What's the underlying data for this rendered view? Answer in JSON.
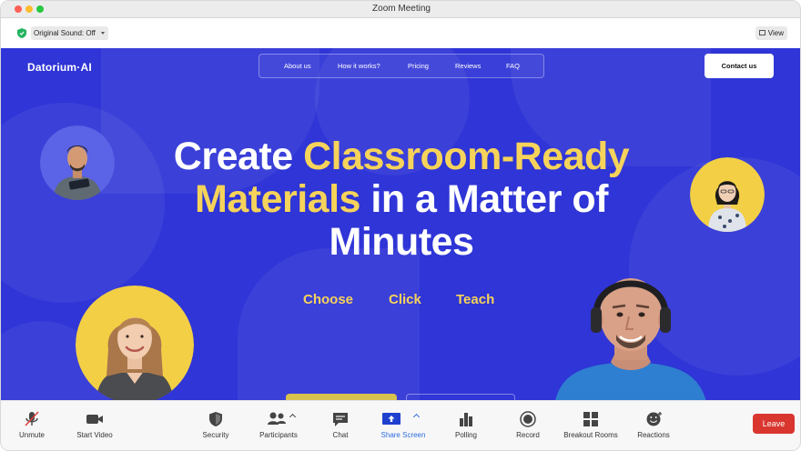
{
  "window": {
    "title": "Zoom Meeting"
  },
  "top_bar": {
    "sound_select": "Original Sound: Off",
    "view_button": "View"
  },
  "shared_screen": {
    "logo": "Datorium·AI",
    "nav": [
      "About us",
      "How it works?",
      "Pricing",
      "Reviews",
      "FAQ"
    ],
    "contact_button": "Contact us",
    "hero": {
      "line1_plain": "Create ",
      "line1_highlight": "Classroom-Ready",
      "line2_highlight": "Materials",
      "line2_plain": " in a Matter of",
      "line3_plain": "Minutes"
    },
    "steps": [
      "Choose",
      "Click",
      "Teach"
    ]
  },
  "toolbar": {
    "items": [
      {
        "label": "Unmute",
        "icon": "muted-mic-icon"
      },
      {
        "label": "Start Video",
        "icon": "video-camera-icon"
      },
      {
        "label": "Security",
        "icon": "shield-icon"
      },
      {
        "label": "Participants",
        "icon": "participants-icon"
      },
      {
        "label": "Chat",
        "icon": "chat-bubble-icon"
      },
      {
        "label": "Share Screen",
        "icon": "share-screen-icon"
      },
      {
        "label": "Polling",
        "icon": "bar-chart-icon"
      },
      {
        "label": "Record",
        "icon": "record-icon"
      },
      {
        "label": "Breakout Rooms",
        "icon": "breakout-rooms-icon"
      },
      {
        "label": "Reactions",
        "icon": "reaction-smiley-icon"
      }
    ],
    "leave_button": "Leave"
  },
  "colors": {
    "screen_bg": "#2f35d6",
    "highlight": "#f6d35a",
    "leave": "#d9362f",
    "share_active": "#2d6cdf",
    "avatar_ring_blue": "#5b63e6",
    "avatar_ring_yellow": "#f2cf45"
  }
}
